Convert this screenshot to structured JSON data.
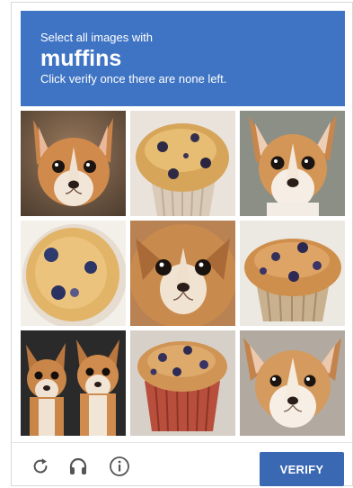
{
  "header": {
    "line1": "Select all images with",
    "target_word": "muffins",
    "line3": "Click verify once there are none left."
  },
  "tiles": [
    {
      "subject": "chihuahua"
    },
    {
      "subject": "blueberry muffin"
    },
    {
      "subject": "chihuahua"
    },
    {
      "subject": "blueberry muffin"
    },
    {
      "subject": "chihuahua"
    },
    {
      "subject": "blueberry muffin"
    },
    {
      "subject": "two chihuahuas"
    },
    {
      "subject": "blueberry muffin"
    },
    {
      "subject": "chihuahua"
    }
  ],
  "footer": {
    "reload_icon": "reload-icon",
    "audio_icon": "headphones-icon",
    "info_icon": "info-icon",
    "verify_label": "VERIFY"
  },
  "colors": {
    "header_bg": "#3f74c4",
    "verify_bg": "#3a68b3"
  }
}
